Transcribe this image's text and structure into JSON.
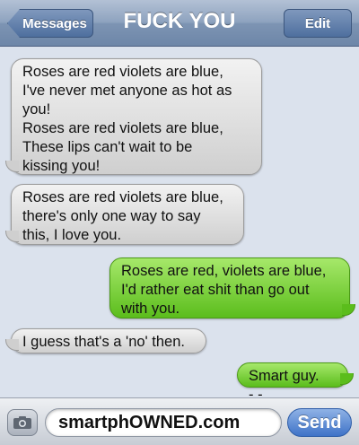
{
  "navbar": {
    "back_label": "Messages",
    "title": "FUCK YOU",
    "edit_label": "Edit"
  },
  "messages": [
    {
      "side": "received",
      "text": "Roses are red violets are blue,\nI've never met anyone as hot as\nyou!\nRoses are red violets are blue,\nThese lips can't wait to be\nkissing you!"
    },
    {
      "side": "received",
      "text": "Roses are red violets are blue,\nthere's only one way to say\nthis, I love you."
    },
    {
      "side": "sent",
      "text": "Roses are red, violets are blue,\nI'd rather eat shit than go out\nwith you."
    },
    {
      "side": "received",
      "text": "I guess that's a 'no' then."
    },
    {
      "side": "sent",
      "text": "Smart guy. -.-"
    }
  ],
  "composer": {
    "input_value": "smartphOWNED.com",
    "send_label": "Send",
    "camera_icon": "camera-icon"
  },
  "colors": {
    "received_bubble": "#d8d8d8",
    "sent_bubble": "#7fd43f",
    "navbar": "#8ea3bf",
    "send_button": "#3f73c8"
  }
}
